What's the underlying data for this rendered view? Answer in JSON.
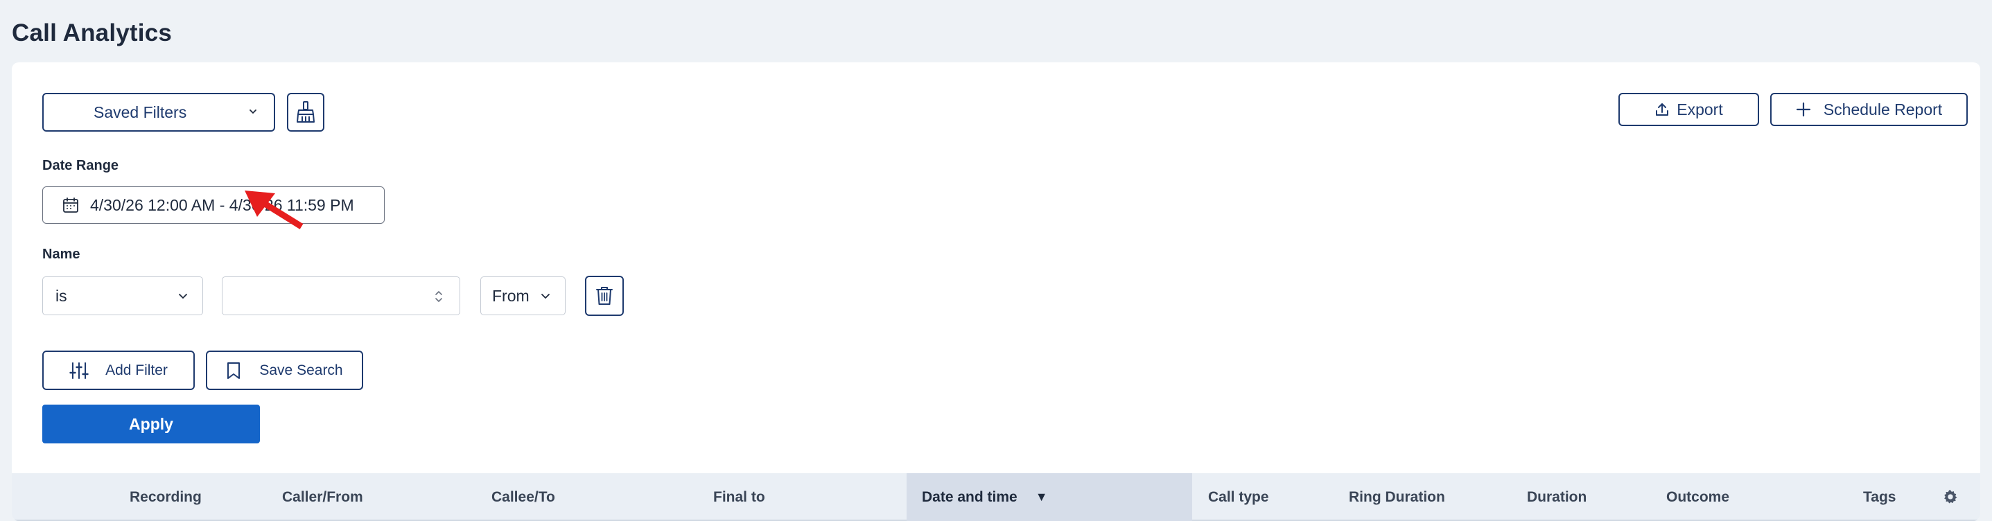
{
  "page": {
    "title": "Call Analytics"
  },
  "toolbar": {
    "saved_filters_label": "Saved Filters",
    "export_label": "Export",
    "schedule_report_label": "Schedule Report"
  },
  "filters": {
    "date_range_label": "Date Range",
    "date_range_value": "4/30/26 12:00 AM - 4/30/26 11:59 PM",
    "name_label": "Name",
    "operator_value": "is",
    "name_value": "",
    "direction_value": "From",
    "add_filter_label": "Add Filter",
    "save_search_label": "Save Search",
    "apply_label": "Apply"
  },
  "table": {
    "columns": [
      "Recording",
      "Caller/From",
      "Callee/To",
      "Final to",
      "Date and time",
      "Call type",
      "Ring Duration",
      "Duration",
      "Outcome",
      "Tags"
    ],
    "sorted_column": "Date and time",
    "sort_direction": "descending"
  },
  "icons": {
    "dropdown": "chevron-down-icon",
    "clear": "broom-icon",
    "export": "upload-icon",
    "schedule": "plus-icon",
    "calendar": "calendar-icon",
    "spinner": "spinner-arrows-icon",
    "delete": "trash-icon",
    "add_filter": "sliders-icon",
    "save_search": "bookmark-icon",
    "settings": "gear-icon",
    "annotation": "red-arrow-icon"
  },
  "colors": {
    "primary": "#1565c9",
    "outline": "#1e3a6e",
    "annotation": "#e61e1e"
  }
}
